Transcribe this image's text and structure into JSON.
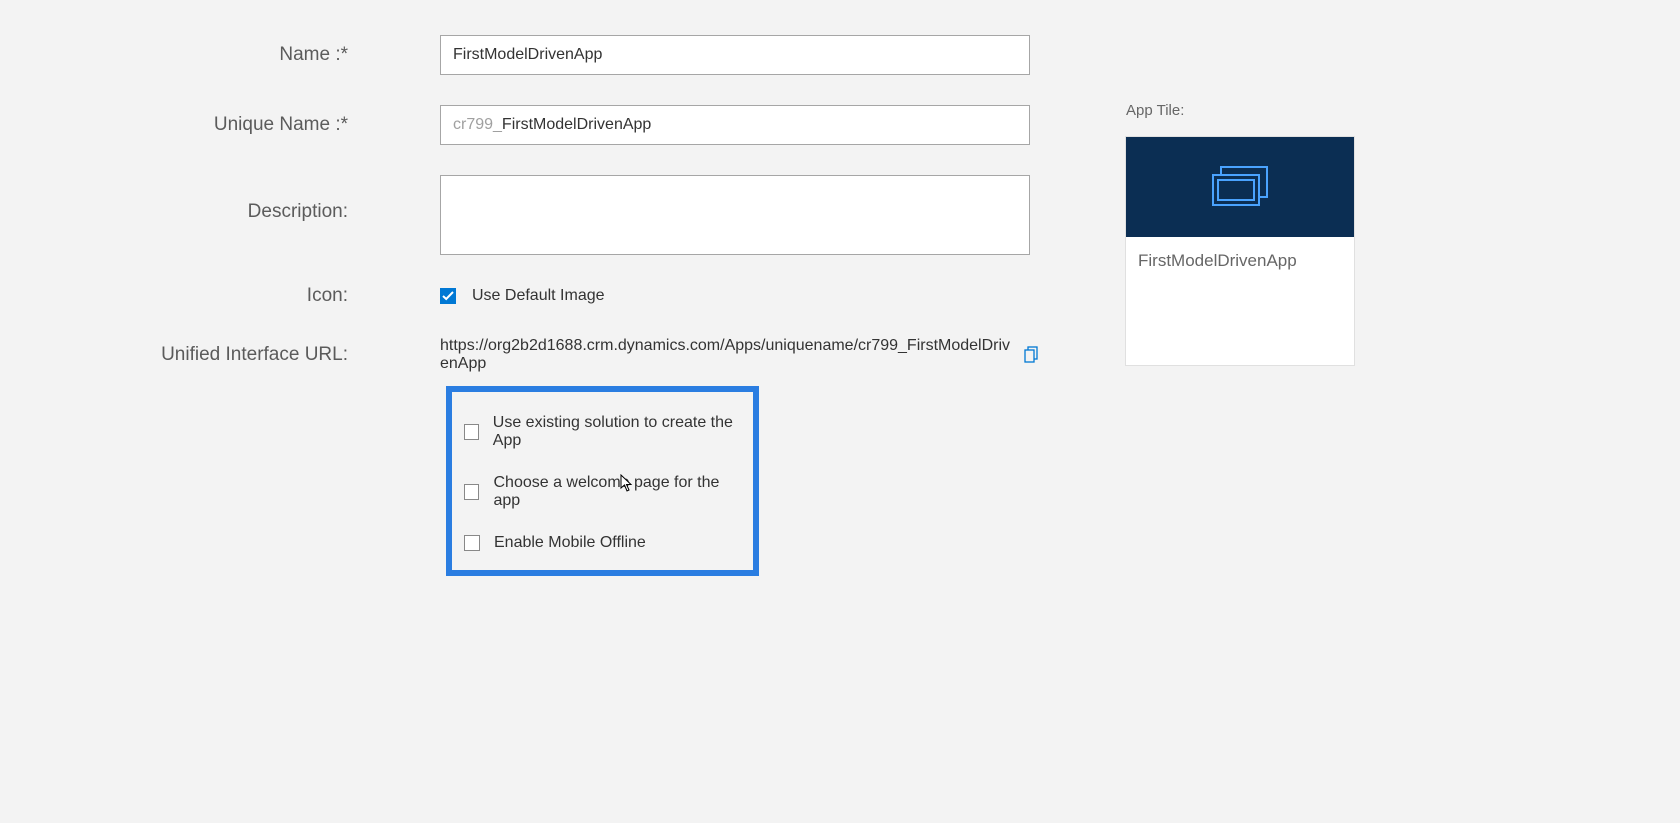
{
  "form": {
    "name": {
      "label": "Name :*",
      "value": "FirstModelDrivenApp"
    },
    "uniqueName": {
      "label": "Unique Name :*",
      "prefix": "cr799_",
      "suffix": "FirstModelDrivenApp"
    },
    "description": {
      "label": "Description:",
      "value": ""
    },
    "icon": {
      "label": "Icon:",
      "useDefaultLabel": "Use Default Image",
      "useDefaultChecked": true
    },
    "url": {
      "label": "Unified Interface URL:",
      "value": "https://org2b2d1688.crm.dynamics.com/Apps/uniquename/cr799_FirstModelDrivenApp"
    }
  },
  "options": {
    "useExistingSolution": {
      "label": "Use existing solution to create the App",
      "checked": false
    },
    "chooseWelcomePage": {
      "label": "Choose a welcome page for the app",
      "checked": false
    },
    "enableMobileOffline": {
      "label": "Enable Mobile Offline",
      "checked": false
    }
  },
  "tile": {
    "heading": "App Tile:",
    "name": "FirstModelDrivenApp"
  }
}
